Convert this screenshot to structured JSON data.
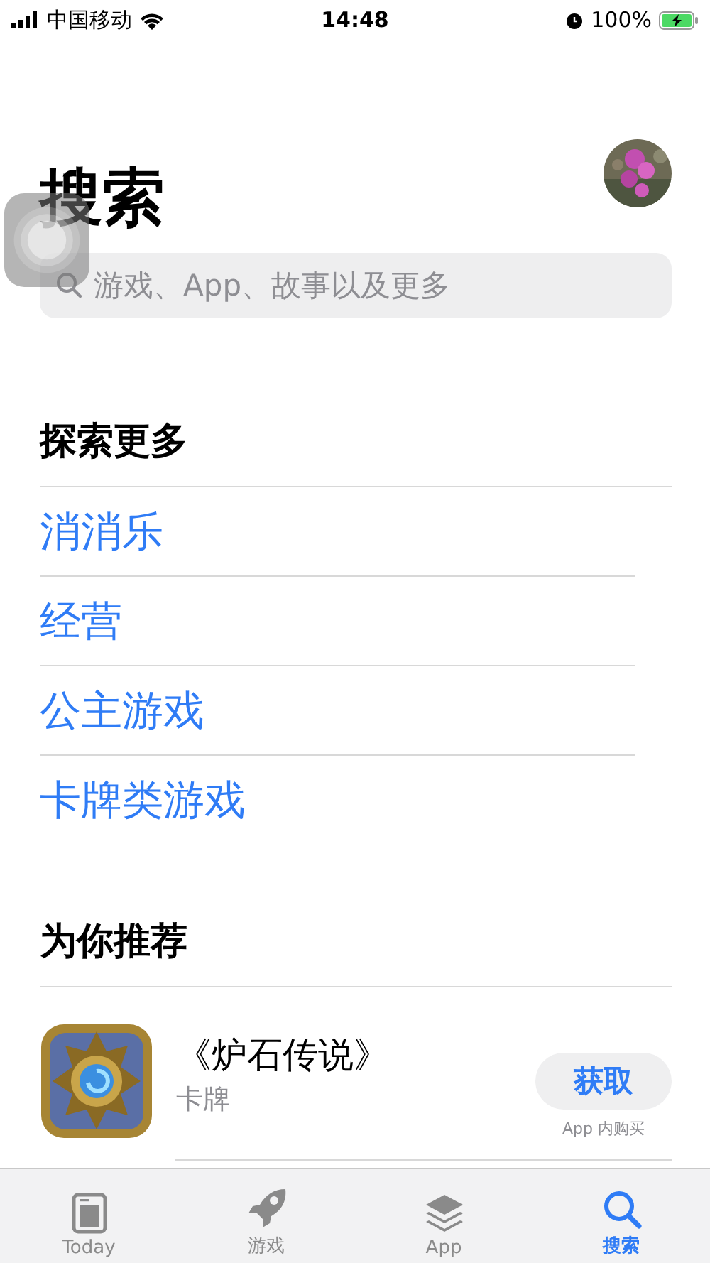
{
  "status_bar": {
    "carrier": "中国移动",
    "time": "14:48",
    "battery": "100%"
  },
  "header": {
    "title": "搜索"
  },
  "search": {
    "placeholder": "游戏、App、故事以及更多"
  },
  "explore": {
    "title": "探索更多",
    "links": [
      "消消乐",
      "经营",
      "公主游戏",
      "卡牌类游戏"
    ]
  },
  "recommended": {
    "title": "为你推荐",
    "apps": [
      {
        "name": "《炉石传说》",
        "category": "卡牌",
        "button": "获取",
        "note": "App 内购买"
      }
    ]
  },
  "tab_bar": [
    {
      "kind": "today",
      "label": "Today",
      "selected": false
    },
    {
      "kind": "games",
      "label": "游戏",
      "selected": false
    },
    {
      "kind": "apps",
      "label": "App",
      "selected": false
    },
    {
      "kind": "search",
      "label": "搜索",
      "selected": true
    }
  ]
}
